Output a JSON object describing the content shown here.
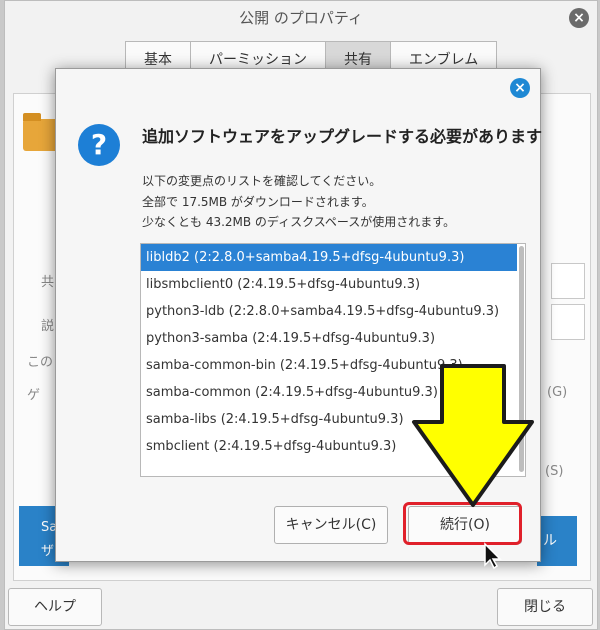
{
  "background_window": {
    "title": "公開 のプロパティ",
    "tabs": [
      {
        "label": "基本"
      },
      {
        "label": "パーミッション"
      },
      {
        "label": "共有"
      },
      {
        "label": "エンブレム"
      }
    ],
    "active_tab": "共有",
    "fragments": [
      "共",
      "説",
      "この",
      "ゲ",
      "(G)",
      "(S)",
      "Sa",
      "ザ",
      "ル"
    ],
    "help_button": "ヘルプ",
    "close_button": "閉じる"
  },
  "dialog": {
    "heading": "追加ソフトウェアをアップグレードする必要があります",
    "message_lines": [
      "以下の変更点のリストを確認してください。",
      "全部で 17.5MB がダウンロードされます。",
      "少なくとも 43.2MB のディスクスペースが使用されます。"
    ],
    "packages": [
      "libldb2 (2:2.8.0+samba4.19.5+dfsg-4ubuntu9.3)",
      "libsmbclient0 (2:4.19.5+dfsg-4ubuntu9.3)",
      "python3-ldb (2:2.8.0+samba4.19.5+dfsg-4ubuntu9.3)",
      "python3-samba (2:4.19.5+dfsg-4ubuntu9.3)",
      "samba-common-bin (2:4.19.5+dfsg-4ubuntu9.3)",
      "samba-common (2:4.19.5+dfsg-4ubuntu9.3)",
      "samba-libs (2:4.19.5+dfsg-4ubuntu9.3)",
      "smbclient (2:4.19.5+dfsg-4ubuntu9.3)"
    ],
    "selected_package_index": 0,
    "cancel_button": "キャンセル(C)",
    "continue_button": "続行(O)"
  },
  "colors": {
    "accent_blue": "#2a82d4",
    "highlight_red": "#e0202a",
    "arrow_yellow": "#ffff00",
    "folder_orange": "#e7a63a"
  },
  "icons": {
    "dialog_icon": "question-icon",
    "dialog_close": "close-icon",
    "window_close": "close-icon",
    "folder": "folder-share-icon"
  }
}
